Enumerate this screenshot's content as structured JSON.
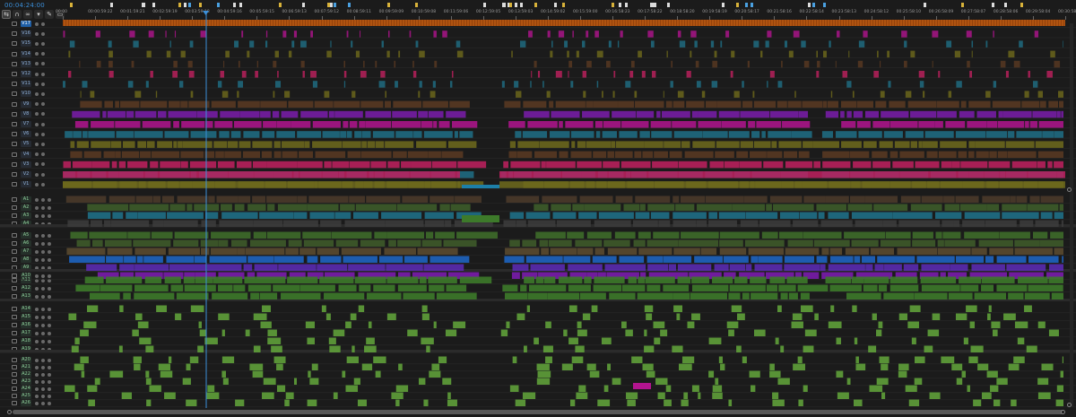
{
  "timeline": {
    "current_timecode": "00:04:24:00",
    "toolbar": [
      {
        "icon": "ripple-icon",
        "active": true
      },
      {
        "icon": "magnet-icon",
        "active": false
      },
      {
        "icon": "linked-selection-icon",
        "active": false
      },
      {
        "icon": "marker-add-icon",
        "active": false
      },
      {
        "icon": "wrench-icon",
        "active": false
      },
      {
        "icon": "caption-icon",
        "active": false
      }
    ],
    "ruler_labels": [
      "00:00",
      "00:00:59:22",
      "00:01:59:21",
      "00:02:59:19",
      "00:03:59:18",
      "00:04:59:16",
      "00:05:59:15",
      "00:06:59:13",
      "00:07:59:12",
      "00:08:59:11",
      "00:09:59:09",
      "00:10:59:08",
      "00:11:59:06",
      "00:12:59:05",
      "00:13:59:03",
      "00:14:59:02",
      "00:15:59:00",
      "00:16:58:23",
      "00:17:58:22",
      "00:18:58:20",
      "00:19:58:19",
      "00:20:58:17",
      "00:21:58:16",
      "00:22:58:14",
      "00:23:58:13",
      "00:24:58:12",
      "00:25:58:10",
      "00:26:58:09",
      "00:27:58:07",
      "00:28:58:06",
      "00:29:58:04",
      "00:30:58:03"
    ],
    "video_tracks": [
      "V17",
      "V16",
      "V15",
      "V14",
      "V13",
      "V12",
      "V11",
      "V10",
      "V9",
      "V8",
      "V7",
      "V6",
      "V5",
      "V4",
      "V3",
      "V2",
      "V1"
    ],
    "audio_tracks_group1": [
      "A1",
      "A2",
      "A3",
      "A4"
    ],
    "audio_tracks_group2": [
      "A5",
      "A6",
      "A7",
      "A8",
      "A9",
      "A10"
    ],
    "audio_tracks_group3": [
      "A11",
      "A12",
      "A13"
    ],
    "audio_tracks_group4": [
      "A14",
      "A15",
      "A16",
      "A17",
      "A18",
      "A19"
    ],
    "audio_tracks_group5": [
      "A20",
      "A21",
      "A22",
      "A23",
      "A24",
      "A25",
      "A26"
    ],
    "colors": {
      "orange_track": "#c05a10",
      "magenta": "#b2148f",
      "purple": "#7a1cac",
      "teal": "#1f6f86",
      "olive": "#6f6a1c",
      "brown": "#5a3a22",
      "pink": "#c0205f",
      "green": "#3d7a2a",
      "light_green": "#5fa03a",
      "blue": "#1e64c0",
      "violet": "#5a2ab0",
      "playhead": "#3b8fd9"
    }
  }
}
